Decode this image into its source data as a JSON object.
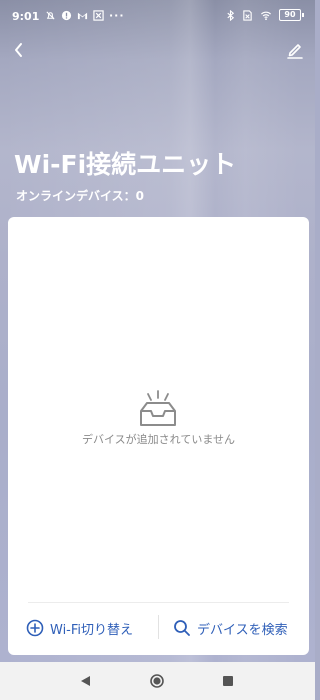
{
  "status_bar": {
    "time": "9:01",
    "dots": "···",
    "battery": "90",
    "left_icons": [
      "notifications-off-icon",
      "alert-circle-icon",
      "gmail-icon",
      "x-box-icon"
    ],
    "right_icons": [
      "bluetooth-icon",
      "sim-x-icon",
      "wifi-icon",
      "battery-icon"
    ]
  },
  "header": {
    "title": "Wi-Fi接続ユニット",
    "subtitle": "オンラインデバイス：0",
    "back_icon": "chevron-left-icon",
    "edit_icon": "pencil-icon"
  },
  "card": {
    "empty_icon": "empty-inbox-icon",
    "empty_text": "デバイスが追加されていません",
    "switch_label": "Wi-Fi切り替え",
    "search_label": "デバイスを検索",
    "accent_color": "#2f5fb8"
  },
  "nav_bar": {
    "icons": [
      "back-triangle-icon",
      "home-circle-icon",
      "recents-square-icon"
    ]
  }
}
